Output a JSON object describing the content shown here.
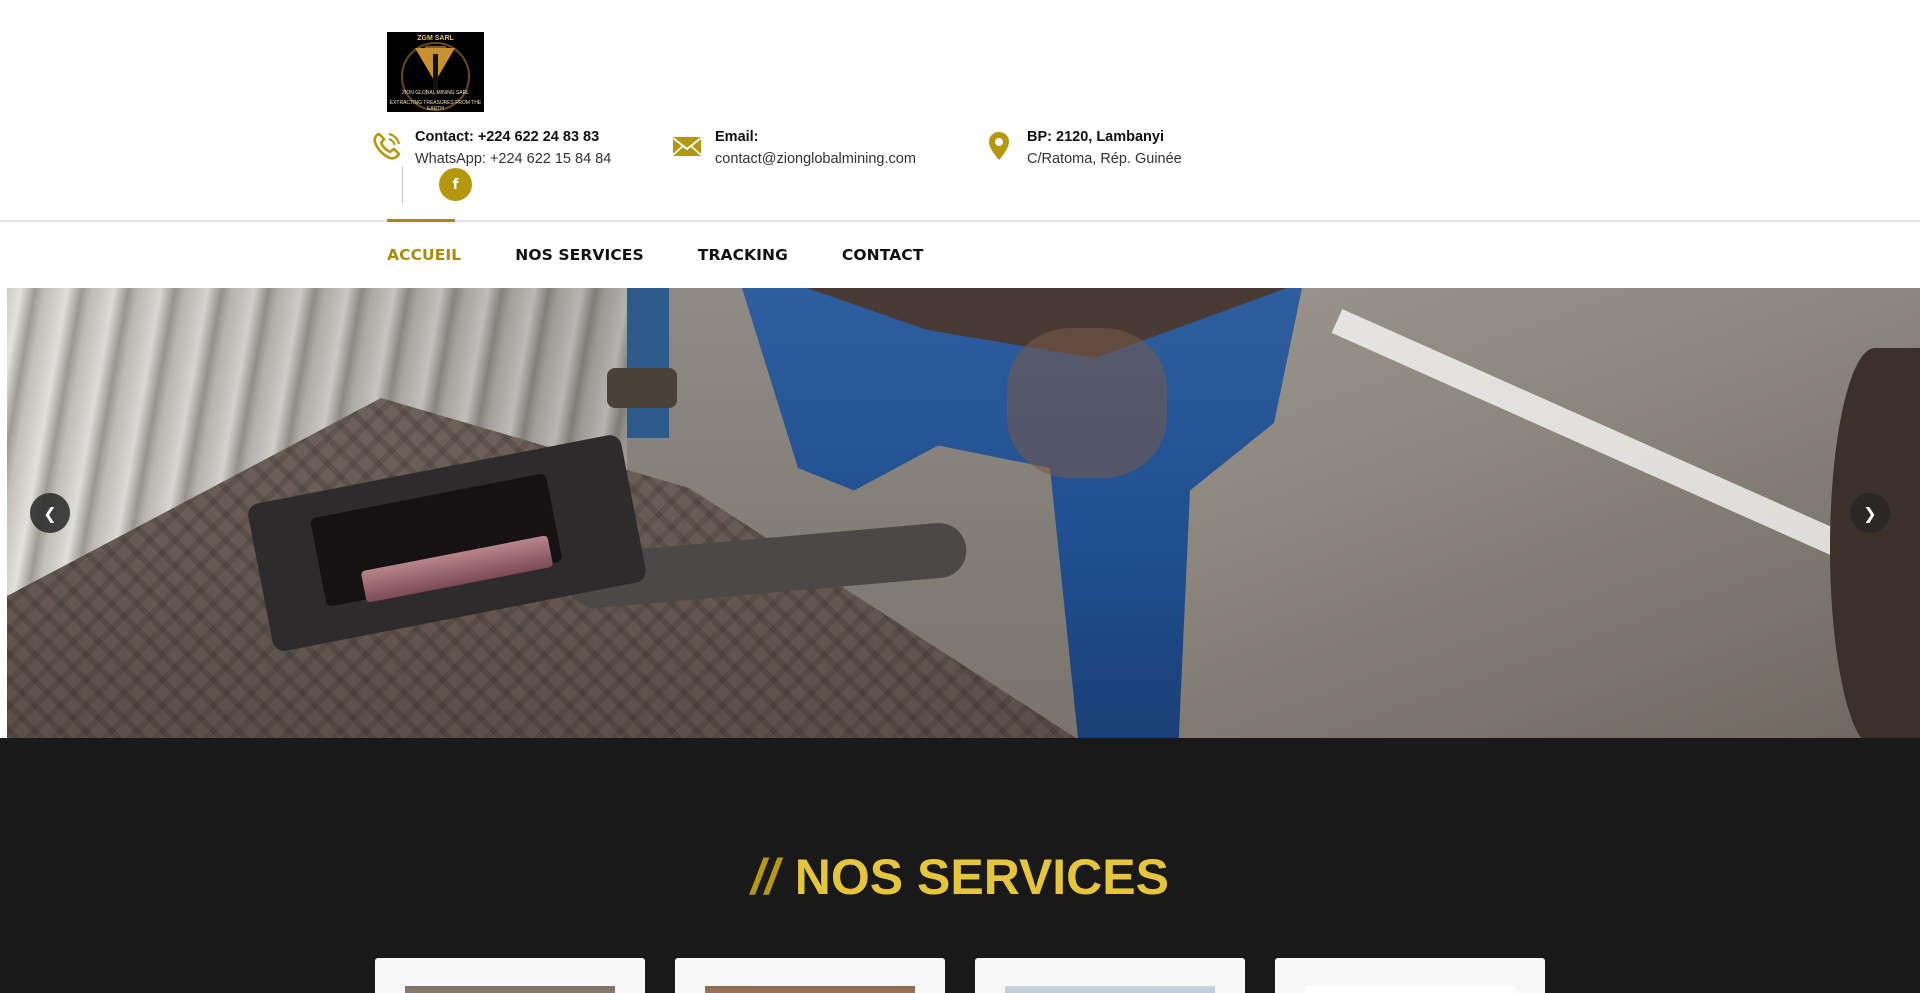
{
  "header": {
    "logo": {
      "top_text": "ZGM SARL",
      "ring_text": "ZION GLOBAL MINING SARL",
      "bottom_text": "EXTRACTING TREASURES FROM THE EARTH"
    },
    "contact_phone": {
      "icon": "phone-icon",
      "line1": "Contact: +224 622 24 83 83",
      "line2": "WhatsApp: +224 622 15 84 84"
    },
    "contact_email": {
      "icon": "envelope-icon",
      "line1": "Email:",
      "line2": "contact@zionglobalmining.com"
    },
    "contact_address": {
      "icon": "map-pin-icon",
      "line1": "BP: 2120, Lambanyi",
      "line2": "C/Ratoma, Rép. Guinée"
    },
    "social": {
      "facebook_glyph": "f"
    }
  },
  "nav": {
    "items": [
      {
        "label": "ACCUEIL",
        "active": true
      },
      {
        "label": "NOS SERVICES",
        "active": false
      },
      {
        "label": "TRACKING",
        "active": false
      },
      {
        "label": "CONTACT",
        "active": false
      }
    ]
  },
  "hero": {
    "prev_glyph": "❮",
    "next_glyph": "❯"
  },
  "services": {
    "slashes": "//",
    "title": "NOS SERVICES"
  },
  "colors": {
    "accent": "#a88a0c",
    "title_yellow": "#e5c53c",
    "dark_bg": "#191919"
  }
}
